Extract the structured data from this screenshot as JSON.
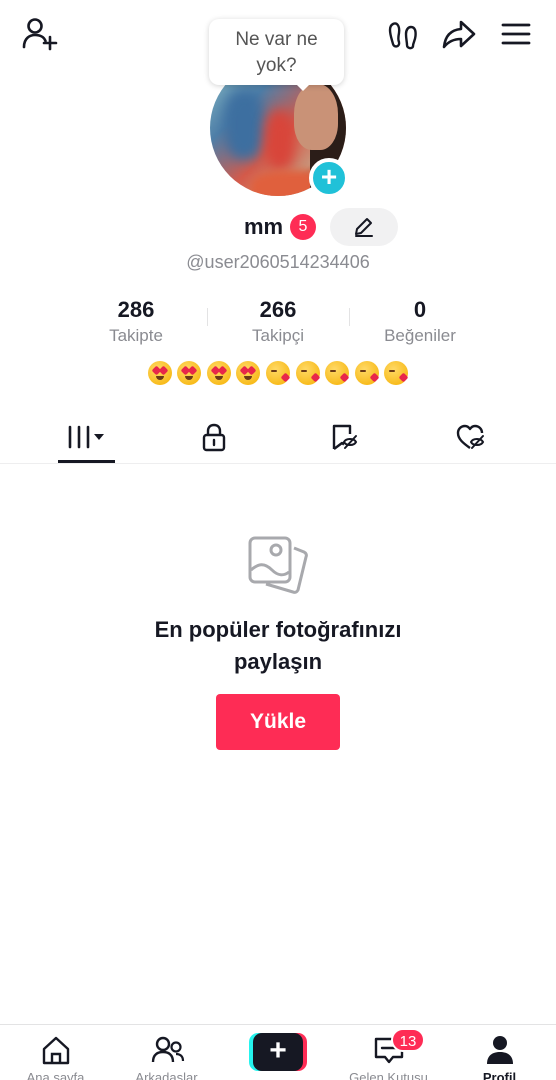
{
  "header": {
    "add_friend_icon": "person-plus-icon",
    "footprints_icon": "footprints-icon",
    "share_icon": "share-arrow-icon",
    "menu_icon": "hamburger-menu-icon"
  },
  "status_bubble": {
    "text_line1": "Ne var ne",
    "text_line2": "yok?"
  },
  "profile": {
    "username": "mm",
    "badge_count": "5",
    "handle": "@user2060514234406"
  },
  "stats": [
    {
      "value": "286",
      "label": "Takipte"
    },
    {
      "value": "266",
      "label": "Takipçi"
    },
    {
      "value": "0",
      "label": "Beğeniler"
    }
  ],
  "bio_emojis": [
    "heart-eyes",
    "heart-eyes",
    "heart-eyes",
    "heart-eyes",
    "kissing-heart",
    "kissing-heart",
    "kissing-heart",
    "kissing-heart",
    "kissing-heart"
  ],
  "tabs": [
    {
      "icon": "grid-menu-icon",
      "active": true
    },
    {
      "icon": "lock-icon"
    },
    {
      "icon": "bookmark-hidden-icon"
    },
    {
      "icon": "heart-hidden-icon"
    }
  ],
  "empty_state": {
    "icon": "photos-icon",
    "title_line1": "En popüler fotoğrafınızı",
    "title_line2": "paylaşın",
    "button_label": "Yükle"
  },
  "bottom_nav": {
    "items": [
      {
        "label": "Ana sayfa",
        "icon": "home-icon"
      },
      {
        "label": "Arkadaşlar",
        "icon": "friends-icon"
      },
      {
        "label": "",
        "icon": "create-plus-icon"
      },
      {
        "label": "Gelen Kutusu",
        "icon": "inbox-icon"
      },
      {
        "label": "Profil",
        "icon": "profile-icon",
        "active": true
      }
    ],
    "inbox_badge": "13"
  },
  "colors": {
    "accent": "#fe2c55",
    "cyan": "#25f4ee",
    "text": "#161823",
    "muted": "#8a8b91"
  }
}
